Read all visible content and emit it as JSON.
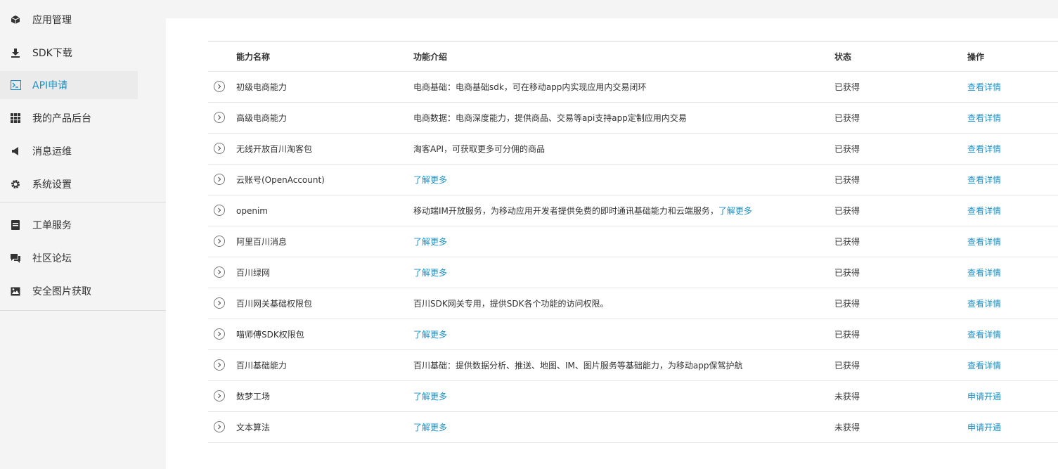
{
  "sidebar": {
    "items": [
      {
        "label": "应用管理",
        "icon": "cube-icon"
      },
      {
        "label": "SDK下载",
        "icon": "download-icon"
      },
      {
        "label": "API申请",
        "icon": "terminal-icon",
        "active": true
      },
      {
        "label": "我的产品后台",
        "icon": "grid-icon"
      },
      {
        "label": "消息运维",
        "icon": "megaphone-icon"
      },
      {
        "label": "系统设置",
        "icon": "gear-icon"
      }
    ],
    "items2": [
      {
        "label": "工单服务",
        "icon": "ticket-icon"
      },
      {
        "label": "社区论坛",
        "icon": "chat-icon"
      },
      {
        "label": "安全图片获取",
        "icon": "image-icon"
      }
    ]
  },
  "table": {
    "headers": {
      "name": "能力名称",
      "desc": "功能介绍",
      "status": "状态",
      "op": "操作"
    },
    "rows": [
      {
        "name": "初级电商能力",
        "desc": "电商基础：电商基础sdk，可在移动app内实现应用内交易闭环",
        "link": "",
        "status": "已获得",
        "op": "查看详情"
      },
      {
        "name": "高级电商能力",
        "desc": "电商数据：电商深度能力，提供商品、交易等api支持app定制应用内交易",
        "link": "",
        "status": "已获得",
        "op": "查看详情"
      },
      {
        "name": "无线开放百川淘客包",
        "desc": "淘客API，可获取更多可分佣的商品",
        "link": "",
        "status": "已获得",
        "op": "查看详情"
      },
      {
        "name": "云账号(OpenAccount)",
        "desc": "",
        "link": "了解更多",
        "status": "已获得",
        "op": "查看详情"
      },
      {
        "name": "openim",
        "desc": "移动端IM开放服务，为移动应用开发者提供免费的即时通讯基础能力和云端服务，",
        "link": "了解更多",
        "status": "已获得",
        "op": "查看详情"
      },
      {
        "name": "阿里百川消息",
        "desc": "",
        "link": "了解更多",
        "status": "已获得",
        "op": "查看详情"
      },
      {
        "name": "百川绿网",
        "desc": "",
        "link": "了解更多",
        "status": "已获得",
        "op": "查看详情"
      },
      {
        "name": "百川网关基础权限包",
        "desc": "百川SDK网关专用，提供SDK各个功能的访问权限。",
        "link": "",
        "status": "已获得",
        "op": "查看详情"
      },
      {
        "name": "喵师傅SDK权限包",
        "desc": "",
        "link": "了解更多",
        "status": "已获得",
        "op": "查看详情"
      },
      {
        "name": "百川基础能力",
        "desc": "百川基础：提供数据分析、推送、地图、IM、图片服务等基础能力，为移动app保驾护航",
        "link": "",
        "status": "已获得",
        "op": "查看详情"
      },
      {
        "name": "数梦工场",
        "desc": "",
        "link": "了解更多",
        "status": "未获得",
        "op": "申请开通"
      },
      {
        "name": "文本算法",
        "desc": "",
        "link": "了解更多",
        "status": "未获得",
        "op": "申请开通"
      }
    ]
  },
  "colors": {
    "accent": "#1a8fc6",
    "text": "#333333",
    "sidebar_bg": "#f4f4f4",
    "active_bg": "#ebebeb"
  }
}
